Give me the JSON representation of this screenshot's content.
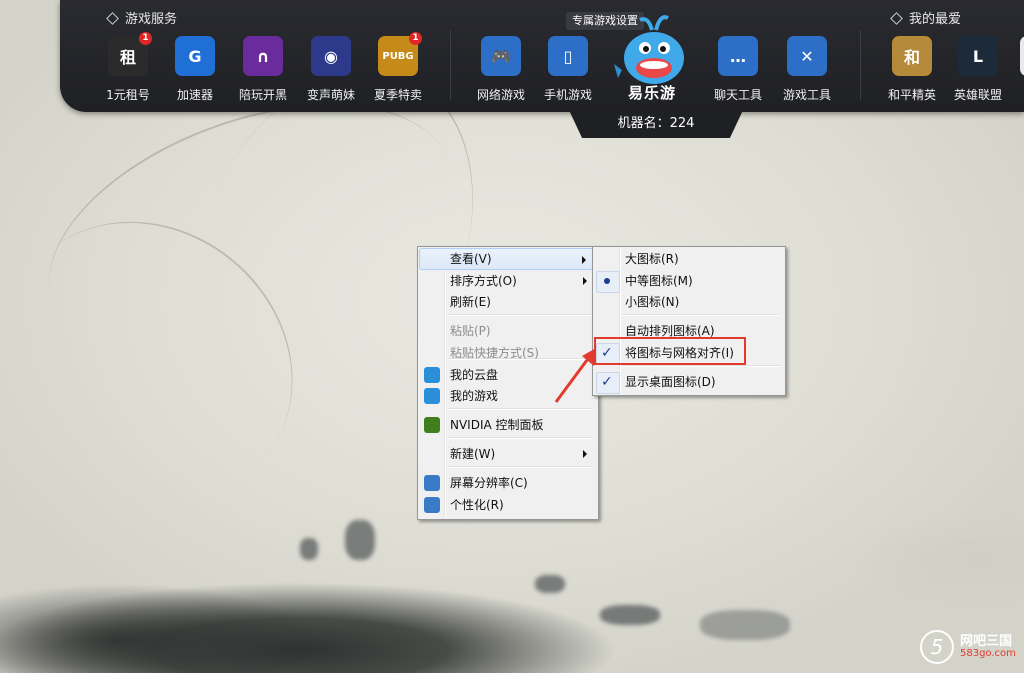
{
  "topbar": {
    "left_section_title": "游戏服务",
    "right_section_title": "我的最爱",
    "services": [
      {
        "label": "1元租号",
        "icon": "rent-account-icon",
        "glyph": "租",
        "badge": "1",
        "color": "#2b2b2b"
      },
      {
        "label": "加速器",
        "icon": "accelerator-icon",
        "glyph": "G",
        "badge": "",
        "color": "#1f6fd6"
      },
      {
        "label": "陪玩开黑",
        "icon": "companion-icon",
        "glyph": "∩",
        "badge": "",
        "color": "#6a2c9c"
      },
      {
        "label": "变声萌妹",
        "icon": "voice-changer-icon",
        "glyph": "◉",
        "badge": "",
        "color": "#2d3a8c"
      },
      {
        "label": "夏季特卖",
        "icon": "pubg-sale-icon",
        "glyph": "PUBG",
        "badge": "1",
        "color": "#c58a1a"
      }
    ],
    "categories": [
      {
        "label": "网络游戏",
        "icon": "gamepad-icon",
        "glyph": "🎮",
        "color": "#2d6fc6"
      },
      {
        "label": "手机游戏",
        "icon": "phone-icon",
        "glyph": "▯",
        "color": "#2d6fc6"
      },
      {
        "label": "聊天工具",
        "icon": "chat-icon",
        "glyph": "…",
        "color": "#2d6fc6"
      },
      {
        "label": "游戏工具",
        "icon": "swords-icon",
        "glyph": "✕",
        "color": "#2d6fc6"
      }
    ],
    "favorites": [
      {
        "label": "和平精英",
        "icon": "peace-elite-icon",
        "glyph": "和",
        "color": "#b58a3a"
      },
      {
        "label": "英雄联盟",
        "icon": "lol-icon",
        "glyph": "L",
        "color": "#1c2a3a"
      },
      {
        "label": "穿",
        "icon": "cf-icon",
        "glyph": "",
        "color": "#eaeaea"
      }
    ],
    "mascot_bubble": "专属游戏设置",
    "logo_text": "易乐游",
    "machine_label": "机器名：224"
  },
  "context_menu": {
    "items": [
      {
        "label": "查看(V)",
        "submenu": true,
        "hover": true
      },
      {
        "label": "排序方式(O)",
        "submenu": true
      },
      {
        "label": "刷新(E)"
      },
      {
        "label": "粘贴(P)",
        "disabled": true
      },
      {
        "label": "粘贴快捷方式(S)",
        "disabled": true
      },
      {
        "label": "我的云盘",
        "icon": "cloud-disk-icon"
      },
      {
        "label": "我的游戏",
        "icon": "my-games-icon"
      },
      {
        "label": "NVIDIA 控制面板",
        "icon": "nvidia-icon"
      },
      {
        "label": "新建(W)",
        "submenu": true
      },
      {
        "label": "屏幕分辨率(C)",
        "icon": "monitor-icon"
      },
      {
        "label": "个性化(R)",
        "icon": "personalize-icon"
      }
    ]
  },
  "view_submenu": {
    "items": [
      {
        "label": "大图标(R)",
        "state": "none"
      },
      {
        "label": "中等图标(M)",
        "state": "radio"
      },
      {
        "label": "小图标(N)",
        "state": "none"
      },
      {
        "label": "自动排列图标(A)",
        "state": "none"
      },
      {
        "label": "将图标与网格对齐(I)",
        "state": "check"
      },
      {
        "label": "显示桌面图标(D)",
        "state": "check"
      }
    ]
  },
  "watermark": {
    "title": "网吧三国",
    "url": "583go.com",
    "logo": "5"
  }
}
